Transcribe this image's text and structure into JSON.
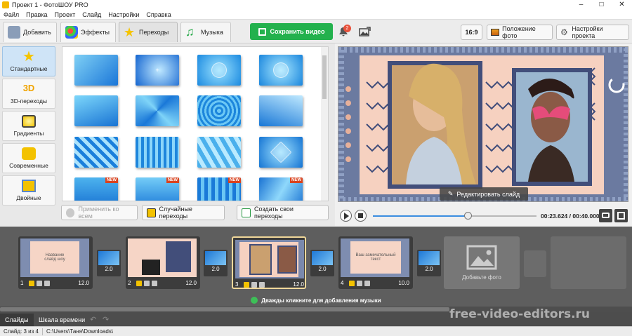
{
  "window": {
    "title": "Проект 1 - ФотоШОУ PRO"
  },
  "menu": [
    "Файл",
    "Правка",
    "Проект",
    "Слайд",
    "Настройки",
    "Справка"
  ],
  "tabs": [
    {
      "label": "Добавить",
      "icon": "folder-plus-icon"
    },
    {
      "label": "Эффекты",
      "icon": "palette-icon"
    },
    {
      "label": "Переходы",
      "icon": "star-icon"
    },
    {
      "label": "Музыка",
      "icon": "music-note-icon"
    }
  ],
  "save_button": "Сохранить видео",
  "notifications_count": "2",
  "aspect_button": "16:9",
  "photo_position_button": "Положение фото",
  "project_settings_button": "Настройки проекта",
  "categories": [
    {
      "label": "Стандартные",
      "icon": "star-icon"
    },
    {
      "label": "3D-переходы",
      "icon": "3d-icon"
    },
    {
      "label": "Градиенты",
      "icon": "gradient-icon"
    },
    {
      "label": "Современные",
      "icon": "puzzle-icon"
    },
    {
      "label": "Двойные",
      "icon": "double-frame-icon"
    }
  ],
  "new_badge": "NEW",
  "apply_all_button": "Применить ко всем",
  "random_transitions_button": "Случайные переходы",
  "create_transitions_button": "Создать свои переходы",
  "edit_slide_button": "Редактировать слайд",
  "playback": {
    "time": "00:23.624 / 00:40.000",
    "progress": 0.58
  },
  "slides": [
    {
      "number": "1",
      "duration": "12.0",
      "caption": "Название\nслайд шоу"
    },
    {
      "number": "2",
      "duration": "12.0"
    },
    {
      "number": "3",
      "duration": "12.0"
    },
    {
      "number": "4",
      "duration": "10.0",
      "caption": "Ваш замечательный\nтекст"
    }
  ],
  "transitions": [
    "2.0",
    "2.0",
    "2.0",
    "2.0"
  ],
  "add_photo": "Добавьте фото",
  "music_hint": "Дважды кликните для добавления музыки",
  "view_tabs": [
    "Слайды",
    "Шкала времени"
  ],
  "watermark": "free-video-editors.ru",
  "status": {
    "slide": "Слайд: 3 из 4",
    "path": "C:\\Users\\Таня\\Downloads\\"
  }
}
